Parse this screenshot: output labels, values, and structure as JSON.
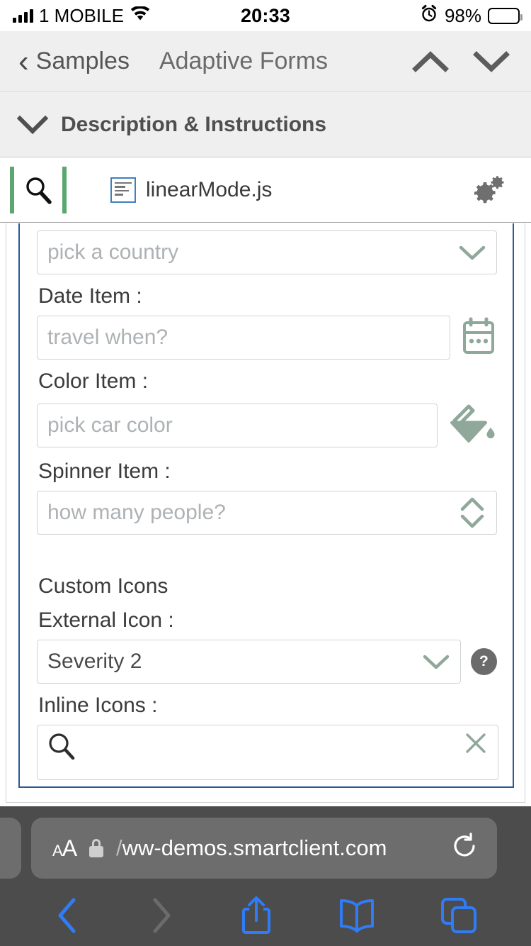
{
  "status_bar": {
    "carrier": "1 MOBILE",
    "time": "20:33",
    "battery_percent": "98%",
    "icons": [
      "signal-bars-icon",
      "wifi-icon",
      "alarm-clock-icon",
      "battery-icon"
    ]
  },
  "nav_bar": {
    "back_label": "Samples",
    "title": "Adaptive Forms",
    "up_icon": "chevron-up-icon",
    "down_icon": "chevron-down-icon"
  },
  "description_bar": {
    "label": "Description & Instructions",
    "caret_icon": "chevron-down-icon"
  },
  "file_bar": {
    "search_icon": "search-icon",
    "file_name": "linearMode.js",
    "file_icon": "source-file-icon",
    "settings_icon": "gears-icon"
  },
  "form": {
    "country": {
      "placeholder": "pick a country",
      "picker_icon": "chevron-down-icon"
    },
    "date": {
      "label": "Date Item :",
      "placeholder": "travel when?",
      "picker_icon": "calendar-icon"
    },
    "color": {
      "label": "Color Item :",
      "placeholder": "pick car color",
      "picker_icon": "paint-bucket-icon"
    },
    "spinner": {
      "label": "Spinner Item :",
      "placeholder": "how many people?",
      "up_icon": "chevron-up-icon",
      "down_icon": "chevron-down-icon"
    },
    "custom_icons_title": "Custom Icons",
    "external_icon": {
      "label": "External Icon :",
      "value": "Severity 2",
      "picker_icon": "chevron-down-icon",
      "help_icon": "question-mark-icon",
      "help_label": "?"
    },
    "inline_icons": {
      "label": "Inline Icons :",
      "value": "",
      "leading_icon": "search-icon",
      "trailing_icon": "clear-x-icon"
    }
  },
  "browser": {
    "text_size_small": "A",
    "text_size_large": "A",
    "lock_icon": "lock-icon",
    "url_prefix": "/",
    "url": "ww-demos.smartclient.com",
    "reload_icon": "reload-icon",
    "back_icon": "chevron-left-icon",
    "forward_icon": "chevron-right-icon",
    "share_icon": "share-icon",
    "bookmarks_icon": "book-icon",
    "tabs_icon": "tabs-icon"
  },
  "colors": {
    "accent_green": "#5aa86f",
    "sage": "#8fa89a",
    "form_border_blue": "#2b5a96",
    "safari_blue": "#2f7cf6",
    "chrome_gray": "#4c4c4c"
  }
}
